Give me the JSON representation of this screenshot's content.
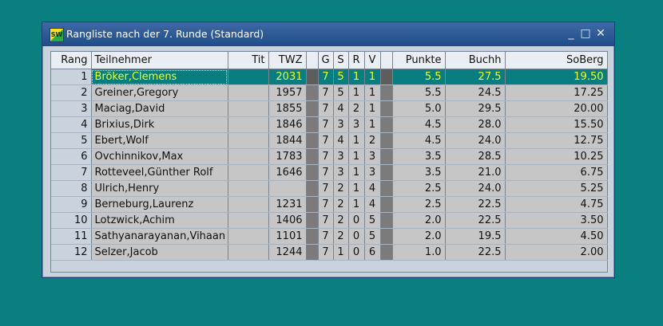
{
  "window": {
    "title": "Rangliste nach der 7. Runde (Standard)",
    "minimize": "_",
    "maximize": "□",
    "close": "✕",
    "icon": "swiss-chess-app-icon"
  },
  "columns": {
    "rang": "Rang",
    "teilnehmer": "Teilnehmer",
    "tit": "Tit",
    "twz": "TWZ",
    "g": "G",
    "s": "S",
    "r": "R",
    "v": "V",
    "punkte": "Punkte",
    "buchh": "Buchh",
    "soberg": "SoBerg"
  },
  "rows": [
    {
      "rang": "1",
      "name": "Bröker,Clemens",
      "tit": "",
      "twz": "2031",
      "g": "7",
      "s": "5",
      "r": "1",
      "v": "1",
      "punkte": "5.5",
      "buchh": "27.5",
      "soberg": "19.50"
    },
    {
      "rang": "2",
      "name": "Greiner,Gregory",
      "tit": "",
      "twz": "1957",
      "g": "7",
      "s": "5",
      "r": "1",
      "v": "1",
      "punkte": "5.5",
      "buchh": "24.5",
      "soberg": "17.25"
    },
    {
      "rang": "3",
      "name": "Maciag,David",
      "tit": "",
      "twz": "1855",
      "g": "7",
      "s": "4",
      "r": "2",
      "v": "1",
      "punkte": "5.0",
      "buchh": "29.5",
      "soberg": "20.00"
    },
    {
      "rang": "4",
      "name": "Brixius,Dirk",
      "tit": "",
      "twz": "1846",
      "g": "7",
      "s": "3",
      "r": "3",
      "v": "1",
      "punkte": "4.5",
      "buchh": "28.0",
      "soberg": "15.50"
    },
    {
      "rang": "5",
      "name": "Ebert,Wolf",
      "tit": "",
      "twz": "1844",
      "g": "7",
      "s": "4",
      "r": "1",
      "v": "2",
      "punkte": "4.5",
      "buchh": "24.0",
      "soberg": "12.75"
    },
    {
      "rang": "6",
      "name": "Ovchinnikov,Max",
      "tit": "",
      "twz": "1783",
      "g": "7",
      "s": "3",
      "r": "1",
      "v": "3",
      "punkte": "3.5",
      "buchh": "28.5",
      "soberg": "10.25"
    },
    {
      "rang": "7",
      "name": "Rotteveel,Günther Rolf",
      "tit": "",
      "twz": "1646",
      "g": "7",
      "s": "3",
      "r": "1",
      "v": "3",
      "punkte": "3.5",
      "buchh": "21.0",
      "soberg": "6.75"
    },
    {
      "rang": "8",
      "name": "Ulrich,Henry",
      "tit": "",
      "twz": "",
      "g": "7",
      "s": "2",
      "r": "1",
      "v": "4",
      "punkte": "2.5",
      "buchh": "24.0",
      "soberg": "5.25"
    },
    {
      "rang": "9",
      "name": "Berneburg,Laurenz",
      "tit": "",
      "twz": "1231",
      "g": "7",
      "s": "2",
      "r": "1",
      "v": "4",
      "punkte": "2.5",
      "buchh": "22.5",
      "soberg": "4.75"
    },
    {
      "rang": "10",
      "name": "Lotzwick,Achim",
      "tit": "",
      "twz": "1406",
      "g": "7",
      "s": "2",
      "r": "0",
      "v": "5",
      "punkte": "2.0",
      "buchh": "22.5",
      "soberg": "3.50"
    },
    {
      "rang": "11",
      "name": "Sathyanarayanan,Vihaan",
      "tit": "",
      "twz": "1101",
      "g": "7",
      "s": "2",
      "r": "0",
      "v": "5",
      "punkte": "2.0",
      "buchh": "19.5",
      "soberg": "4.50"
    },
    {
      "rang": "12",
      "name": "Selzer,Jacob",
      "tit": "",
      "twz": "1244",
      "g": "7",
      "s": "1",
      "r": "0",
      "v": "6",
      "punkte": "1.0",
      "buchh": "22.5",
      "soberg": "2.00"
    }
  ],
  "selected_row": 0,
  "colors": {
    "desktop": "#0a7f7f",
    "selection_bg": "#087e80",
    "selection_text": "#f1ff28",
    "titlebar": "#2a568f"
  }
}
